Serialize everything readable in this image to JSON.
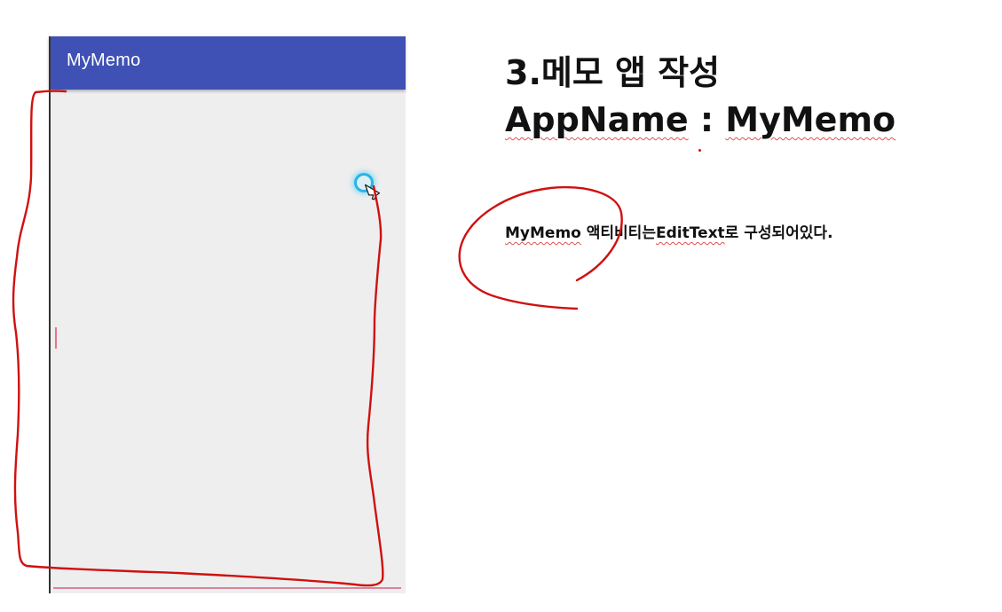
{
  "app": {
    "title": "MyMemo"
  },
  "slide": {
    "heading_line1": "3.메모 앱 작성",
    "heading_line2_key": "AppName",
    "heading_line2_sep": " : ",
    "heading_line2_value": "MyMemo",
    "description_part1": "MyMemo",
    "description_part2": " 액티비티는",
    "description_part3": "EditText",
    "description_part4": "로 구성되어있다."
  },
  "colors": {
    "appbar": "#3f51b5",
    "content_bg": "#eeeeee",
    "annotation": "#d01010",
    "touch_ring": "#27b4e6",
    "edittext_line": "#d9849a"
  },
  "icons": {
    "pointer": "mouse-pointer-icon",
    "touch": "touch-indicator-icon"
  }
}
